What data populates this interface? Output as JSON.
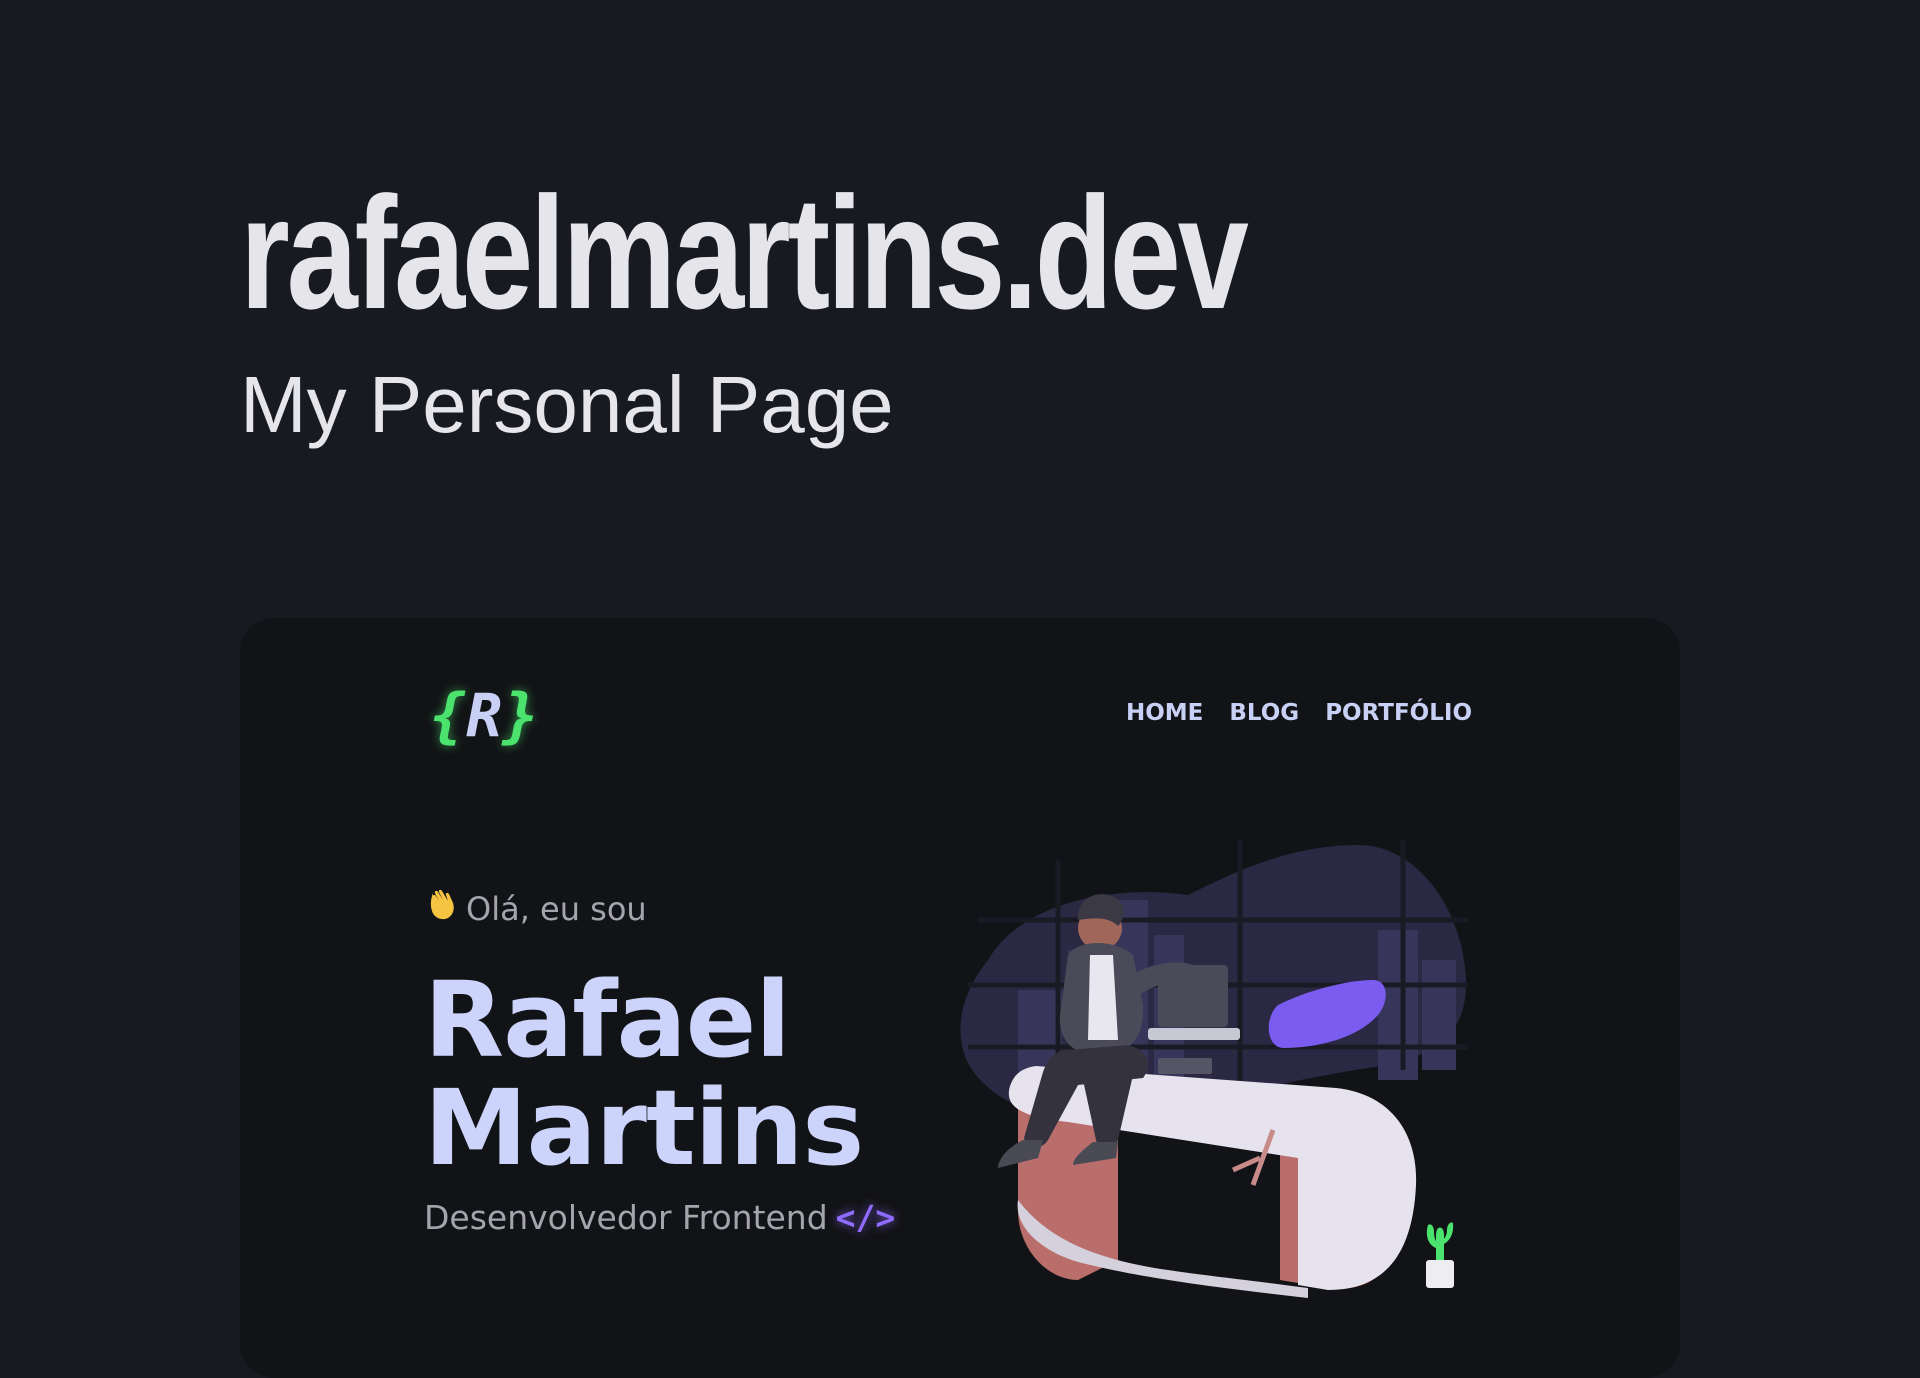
{
  "page": {
    "title": "rafaelmartins.dev",
    "subtitle": "My Personal Page"
  },
  "preview": {
    "logo": {
      "open_brace": "{",
      "letter": "R",
      "close_brace": "}"
    },
    "nav": [
      {
        "label": "HOME"
      },
      {
        "label": "BLOG"
      },
      {
        "label": "PORTFÓLIO"
      }
    ],
    "hero": {
      "greeting": "Olá, eu sou",
      "name_line1": "Rafael",
      "name_line2": "Martins",
      "role": "Desenvolvedor Frontend",
      "role_icon": "</>"
    },
    "icons": {
      "greeting": "waving-hand-icon",
      "role": "code-icon"
    },
    "colors": {
      "page_background": "#171a21",
      "card_background": "#121316",
      "logo_accent": "#4be26e",
      "name_text": "#ccd4fb",
      "code_accent": "#8f6bff"
    }
  }
}
